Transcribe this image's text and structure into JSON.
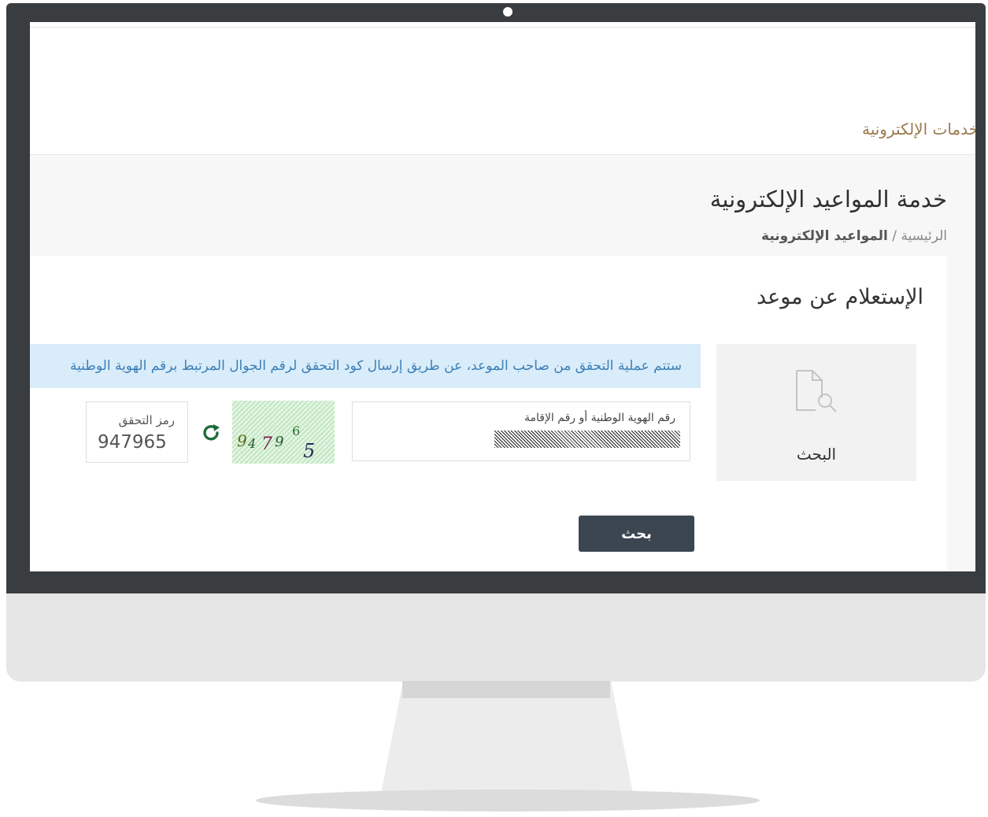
{
  "site": {
    "eservices_link": "خدمات الإلكترونية"
  },
  "page": {
    "title": "خدمة المواعيد الإلكترونية",
    "breadcrumb": {
      "home": "الرئيسية",
      "separator": " / ",
      "current": "المواعيد الإلكترونية"
    }
  },
  "inquiry": {
    "title": "الإستعلام عن موعد",
    "search_tile_label": "البحث",
    "alert_text": "ستتم عملية التحقق من صاحب الموعد، عن طريق إرسال كود التحقق لرقم الجوال المرتبط برقم الهوية الوطنية",
    "id_field_label": "رقم الهوية الوطنية أو رقم الإقامة",
    "captcha_text": "947965",
    "verification_label": "رمز التحقق",
    "verification_value": "947965",
    "submit_label": "بحث"
  },
  "colors": {
    "accent_gold": "#9a7a4e",
    "alert_bg": "#d8ecfa",
    "alert_text": "#3d7fb5",
    "button_bg": "#3b4651",
    "refresh_icon": "#1f6b3a"
  },
  "icons": {
    "search_tile": "document-search-icon",
    "refresh": "refresh-icon"
  }
}
